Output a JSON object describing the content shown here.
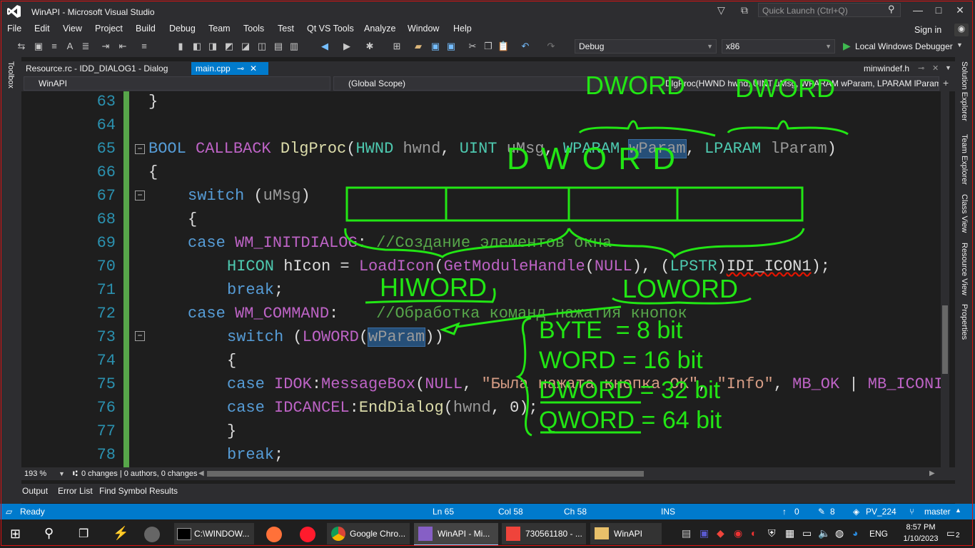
{
  "window": {
    "title": "WinAPI - Microsoft Visual Studio",
    "quick_launch": "Quick Launch (Ctrl+Q)",
    "sign_in": "Sign in"
  },
  "menu": [
    "File",
    "Edit",
    "View",
    "Project",
    "Build",
    "Debug",
    "Team",
    "Tools",
    "Test",
    "Qt VS Tools",
    "Analyze",
    "Window",
    "Help"
  ],
  "toolbar": {
    "config": "Debug",
    "platform": "x86",
    "debugger": "Local Windows Debugger"
  },
  "side_tabs": {
    "left": "Toolbox",
    "right": [
      "Solution Explorer",
      "Team Explorer",
      "Class View",
      "Resource View",
      "Properties"
    ]
  },
  "tabs": {
    "first": "Resource.rc - IDD_DIALOG1 - Dialog",
    "active": "main.cpp",
    "right": "minwindef.h"
  },
  "nav": {
    "project": "WinAPI",
    "scope": "(Global Scope)",
    "member": "DlgProc(HWND hwnd, UINT uMsg, WPARAM wParam, LPARAM lParam"
  },
  "editor": {
    "line_numbers": [
      "63",
      "64",
      "65",
      "66",
      "67",
      "68",
      "69",
      "70",
      "71",
      "72",
      "73",
      "74",
      "75",
      "76",
      "77",
      "78"
    ]
  },
  "zoom": "193 %",
  "codelens": "0 changes | 0 authors, 0 changes",
  "bottom_tabs": [
    "Output",
    "Error List",
    "Find Symbol Results"
  ],
  "status": {
    "ready": "Ready",
    "ln": "Ln 65",
    "col": "Col 58",
    "ch": "Ch 58",
    "ins": "INS",
    "up": "0",
    "edits": "8",
    "repo": "PV_224",
    "branch": "master"
  },
  "taskbar": {
    "apps": [
      "C:\\WINDOW...",
      "Google Chro...",
      "WinAPI - Mi...",
      "730561180 - ...",
      "WinAPI"
    ],
    "lang": "ENG",
    "time": "8:57 PM",
    "date": "1/10/2023",
    "notif": "2"
  },
  "annotations": {
    "dword_top_left": "DWORD",
    "dword_top_right": "DWORD",
    "dword_mid": "D W O R D",
    "hiword": "HIWORD",
    "loword": "LOWORD",
    "sizes": [
      "BYTE  = 8 bit",
      "WORD = 16 bit",
      "DWORD = 32 bit",
      "QWORD = 64 bit"
    ]
  }
}
